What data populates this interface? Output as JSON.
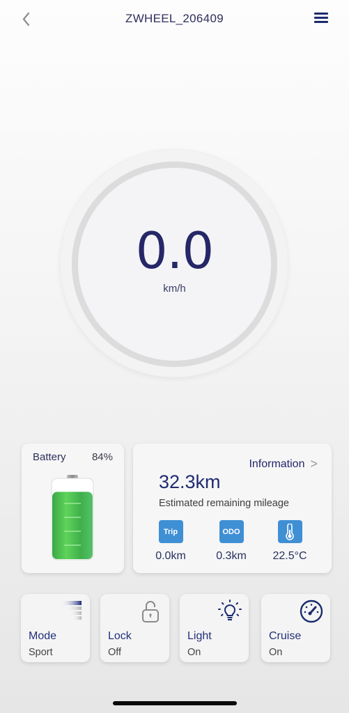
{
  "header": {
    "title": "ZWHEEL_206409",
    "back_icon": "chevron-left-icon",
    "menu_icon": "hamburger-menu-icon"
  },
  "speedometer": {
    "speed": "0.0",
    "unit": "km/h"
  },
  "battery": {
    "label": "Battery",
    "percent_text": "84%",
    "level_fraction": 0.84,
    "fill_color": "#4cc24f"
  },
  "information": {
    "link_label": "Information",
    "chevron": ">",
    "remaining_mileage": "32.3km",
    "remaining_mileage_label": "Estimated remaining mileage",
    "stats": [
      {
        "icon_label": "Trip",
        "icon": "trip-icon",
        "value": "0.0km"
      },
      {
        "icon_label": "ODO",
        "icon": "odometer-icon",
        "value": "0.3km"
      },
      {
        "icon_label": "",
        "icon": "thermometer-icon",
        "value": "22.5°C"
      }
    ],
    "icon_color": "#3f8fd5"
  },
  "controls": [
    {
      "label": "Mode",
      "value": "Sport",
      "icon": "speed-mode-icon"
    },
    {
      "label": "Lock",
      "value": "Off",
      "icon": "unlocked-padlock-icon"
    },
    {
      "label": "Light",
      "value": "On",
      "icon": "lightbulb-icon"
    },
    {
      "label": "Cruise",
      "value": "On",
      "icon": "speedometer-icon"
    }
  ],
  "colors": {
    "primary_text": "#23266a",
    "accent_blue": "#3f8fd5",
    "battery_green": "#4cc24f"
  }
}
